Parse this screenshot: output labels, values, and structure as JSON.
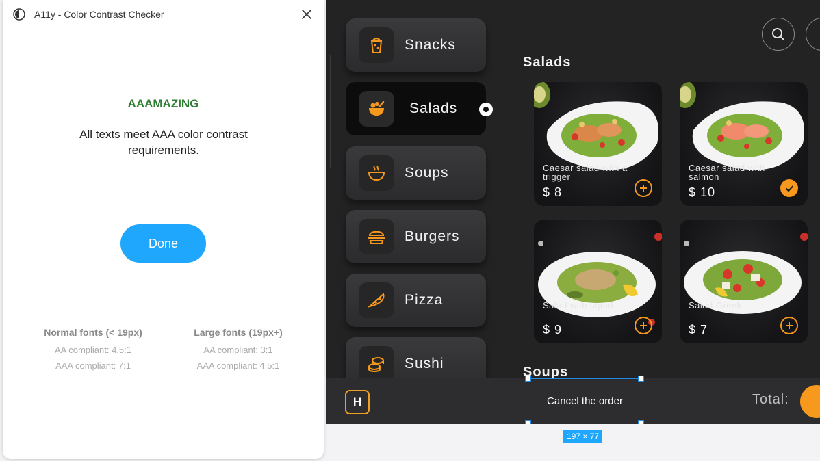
{
  "plugin": {
    "title": "A11y - Color Contrast Checker",
    "result_heading": "AAAMAZING",
    "result_text": "All texts meet AAA color contrast requirements.",
    "done_label": "Done",
    "normal_fonts": {
      "title": "Normal fonts (< 19px)",
      "aa": "AA compliant: 4.5:1",
      "aaa": "AAA compliant: 7:1"
    },
    "large_fonts": {
      "title": "Large fonts (19px+)",
      "aa": "AA compliant: 3:1",
      "aaa": "AAA compliant: 4.5:1"
    },
    "colors": {
      "heading": "#2e7d32",
      "button": "#1ea7fd"
    }
  },
  "app": {
    "categories": [
      {
        "label": "Snacks",
        "icon": "snack-icon"
      },
      {
        "label": "Salads",
        "icon": "salad-bowl-icon",
        "selected": true
      },
      {
        "label": "Soups",
        "icon": "soup-bowl-icon"
      },
      {
        "label": "Burgers",
        "icon": "burger-icon"
      },
      {
        "label": "Pizza",
        "icon": "pizza-slice-icon"
      },
      {
        "label": "Sushi",
        "icon": "sushi-icon"
      }
    ],
    "salads_title": "Salads",
    "soups_title": "Soups",
    "products": [
      {
        "name": "Caesar salad with a trigger",
        "price": "$ 8",
        "action": "add-icon"
      },
      {
        "name": "Caesar salad with salmon",
        "price": "$ 10",
        "action": "check-icon"
      },
      {
        "name": "Salad with squid",
        "price": "$ 9",
        "action": "add-icon"
      },
      {
        "name": "Salad Greek",
        "price": "$ 7",
        "action": "add-icon"
      }
    ],
    "logo_letter": "H",
    "cancel_label": "Cancel the order",
    "total_label": "Total:",
    "selection_size": "197 × 77",
    "accent": "#f7991c"
  }
}
